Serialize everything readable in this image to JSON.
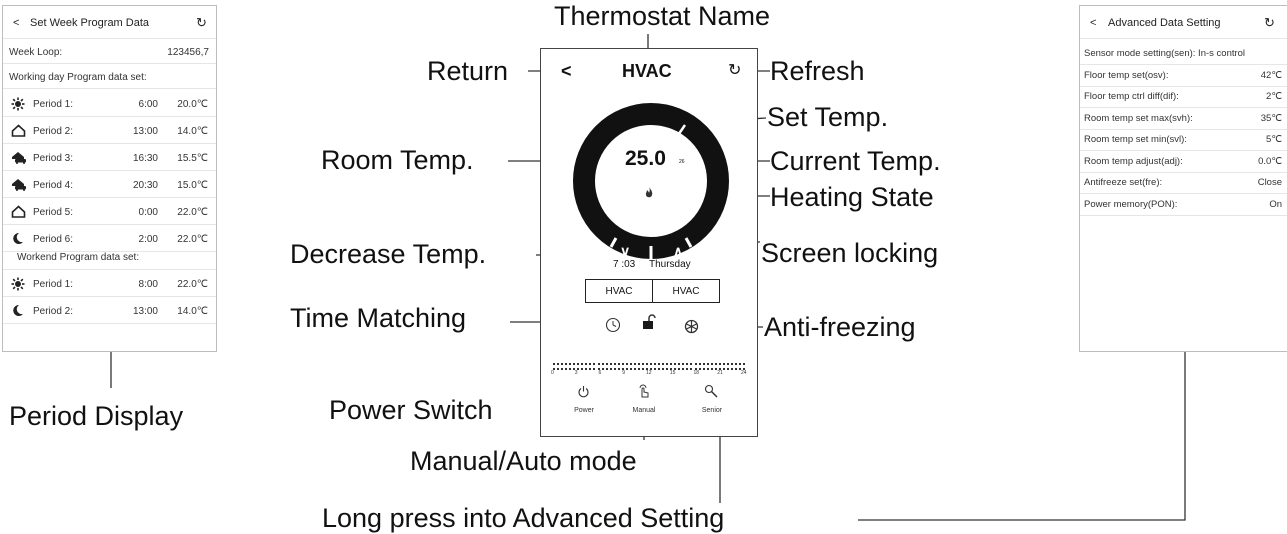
{
  "left_panel": {
    "back_glyph": "<",
    "title": "Set Week Program Data",
    "refresh_glyph": "↻",
    "week_loop_label": "Week Loop:",
    "week_loop_value": "123456,7",
    "working_header": "Working day Program data set:",
    "working_periods": [
      {
        "icon": "sun-icon",
        "label": "Period 1:",
        "time": "6:00",
        "temp": "20.0℃"
      },
      {
        "icon": "home-icon",
        "label": "Period 2:",
        "time": "13:00",
        "temp": "14.0℃"
      },
      {
        "icon": "car-home-icon",
        "label": "Period 3:",
        "time": "16:30",
        "temp": "15.5℃"
      },
      {
        "icon": "car-home-icon",
        "label": "Period 4:",
        "time": "20:30",
        "temp": "15.0℃"
      },
      {
        "icon": "home-icon",
        "label": "Period 5:",
        "time": "0:00",
        "temp": "22.0℃"
      },
      {
        "icon": "moon-icon",
        "label": "Period 6:",
        "time": "2:00",
        "temp": "22.0℃"
      }
    ],
    "weekend_header": "Workend Program data set:",
    "weekend_periods": [
      {
        "icon": "sun-icon",
        "label": "Period 1:",
        "time": "8:00",
        "temp": "22.0℃"
      },
      {
        "icon": "moon-icon",
        "label": "Period 2:",
        "time": "13:00",
        "temp": "14.0℃"
      }
    ]
  },
  "right_panel": {
    "back_glyph": "<",
    "title": "Advanced Data Setting",
    "refresh_glyph": "↻",
    "rows": [
      {
        "label": "Sensor mode setting(sen): In-s control",
        "value": ""
      },
      {
        "label": "Floor temp set(osv):",
        "value": "42℃"
      },
      {
        "label": "Floor temp ctrl diff(dif):",
        "value": "2℃"
      },
      {
        "label": "Room temp set max(svh):",
        "value": "35℃"
      },
      {
        "label": "Room temp set min(svl):",
        "value": "5℃"
      },
      {
        "label": "Room temp adjust(adj):",
        "value": "0.0℃"
      },
      {
        "label": "Antifreeze set(fre):",
        "value": "Close"
      },
      {
        "label": "Power memory(PON):",
        "value": "On"
      }
    ]
  },
  "phone": {
    "back_glyph": "<",
    "name": "HVAC",
    "refresh_glyph": "↻",
    "room_temp": "25.0",
    "current_temp_small": "26",
    "decrease_glyph": "∨",
    "increase_glyph": "∧",
    "time": "7 :03",
    "day": "Thursday",
    "box1": "HVAC",
    "box2": "HVAC",
    "power_label": "Power",
    "manual_label": "Manual",
    "senior_label": "Senior",
    "hour_ticks": [
      "0",
      "3",
      "6",
      "9",
      "12",
      "15",
      "18",
      "21",
      "24"
    ]
  },
  "callouts": {
    "thermostat_name": "Thermostat Name",
    "return": "Return",
    "refresh": "Refresh",
    "set_temp": "Set Temp.",
    "room_temp": "Room Temp.",
    "current_temp": "Current Temp.",
    "heating_state": "Heating State",
    "decrease_temp": "Decrease Temp.",
    "screen_locking": "Screen locking",
    "time_matching": "Time Matching",
    "anti_freezing": "Anti-freezing",
    "power_switch": "Power Switch",
    "manual_auto": "Manual/Auto mode",
    "long_press": "Long press into Advanced Setting",
    "period_display": "Period Display"
  },
  "colors": {
    "ring": "#111111",
    "line": "#333333",
    "panel_border": "#bdbdbd"
  }
}
